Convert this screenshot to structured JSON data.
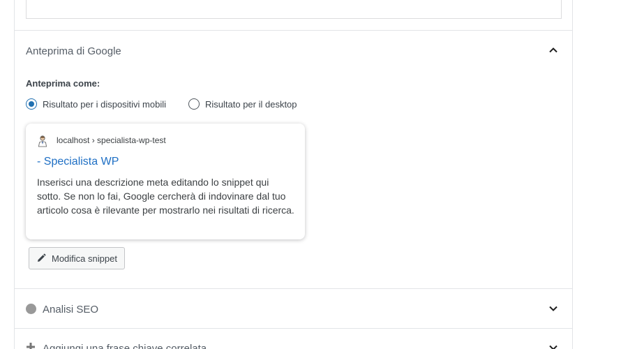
{
  "google_preview": {
    "section_title": "Anteprima di Google",
    "preview_as_label": "Anteprima come:",
    "options": [
      {
        "label": "Risultato per i dispositivi mobili",
        "checked": true
      },
      {
        "label": "Risultato per il desktop",
        "checked": false
      }
    ],
    "card": {
      "breadcrumb": "localhost › specialista-wp-test",
      "title": "- Specialista WP",
      "description": "Inserisci una descrizione meta editando lo snippet qui sotto. Se non lo fai, Google cercherà di indovinare dal tuo articolo cosa è rilevante per mostrarlo nei risultati di ricerca."
    },
    "edit_button_label": "Modifica snippet"
  },
  "seo_analysis": {
    "section_title": "Analisi SEO",
    "status_color": "#999999"
  },
  "related_keyphrase": {
    "section_title": "Aggiungi una frase chiave correlata"
  },
  "colors": {
    "link_blue": "#1e6fc4",
    "radio_accent": "#2271b1",
    "border": "#e2e4e7"
  }
}
